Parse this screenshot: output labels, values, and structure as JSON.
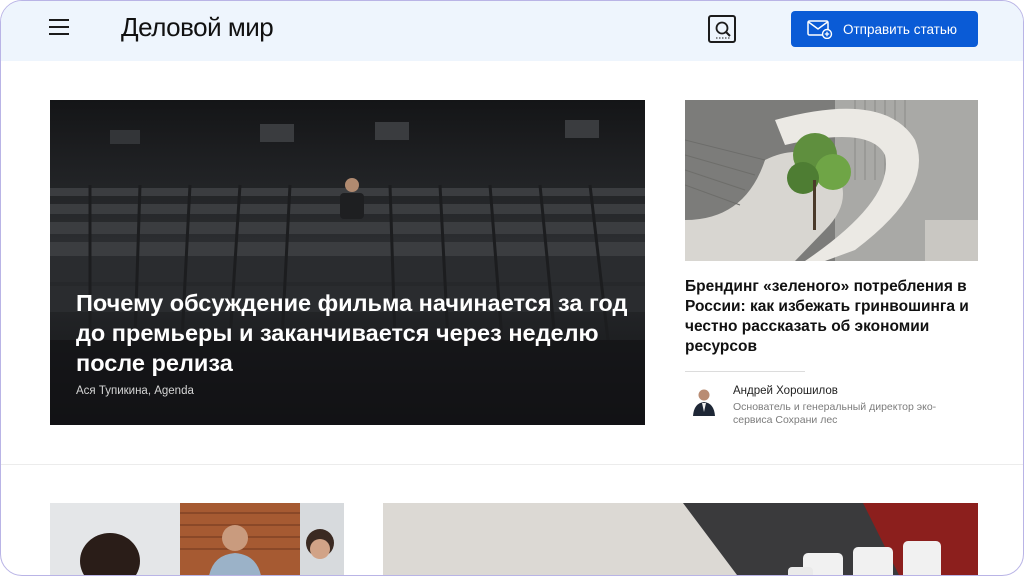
{
  "header": {
    "logo_text": "Деловой мир",
    "submit_label": "Отправить статью",
    "icons": {
      "menu": "hamburger-menu-icon",
      "search": "search-icon",
      "submit": "mail-icon"
    },
    "colors": {
      "header_bg": "#eef5fd",
      "accent": "#0a5bd6"
    }
  },
  "hero": {
    "title": "Почему обсуждение фильма начинается за год до премьеры и заканчивается через неделю после релиза",
    "author": "Ася Тупикина, Agenda"
  },
  "side_article": {
    "title": "Брендинг «зеленого» потребления в России: как избежать гринвошинга и честно рассказать об экономии ресурсов",
    "author_name": "Андрей Хорошилов",
    "author_role": "Основатель и генеральный директор эко-сервиса Сохрани лес"
  }
}
